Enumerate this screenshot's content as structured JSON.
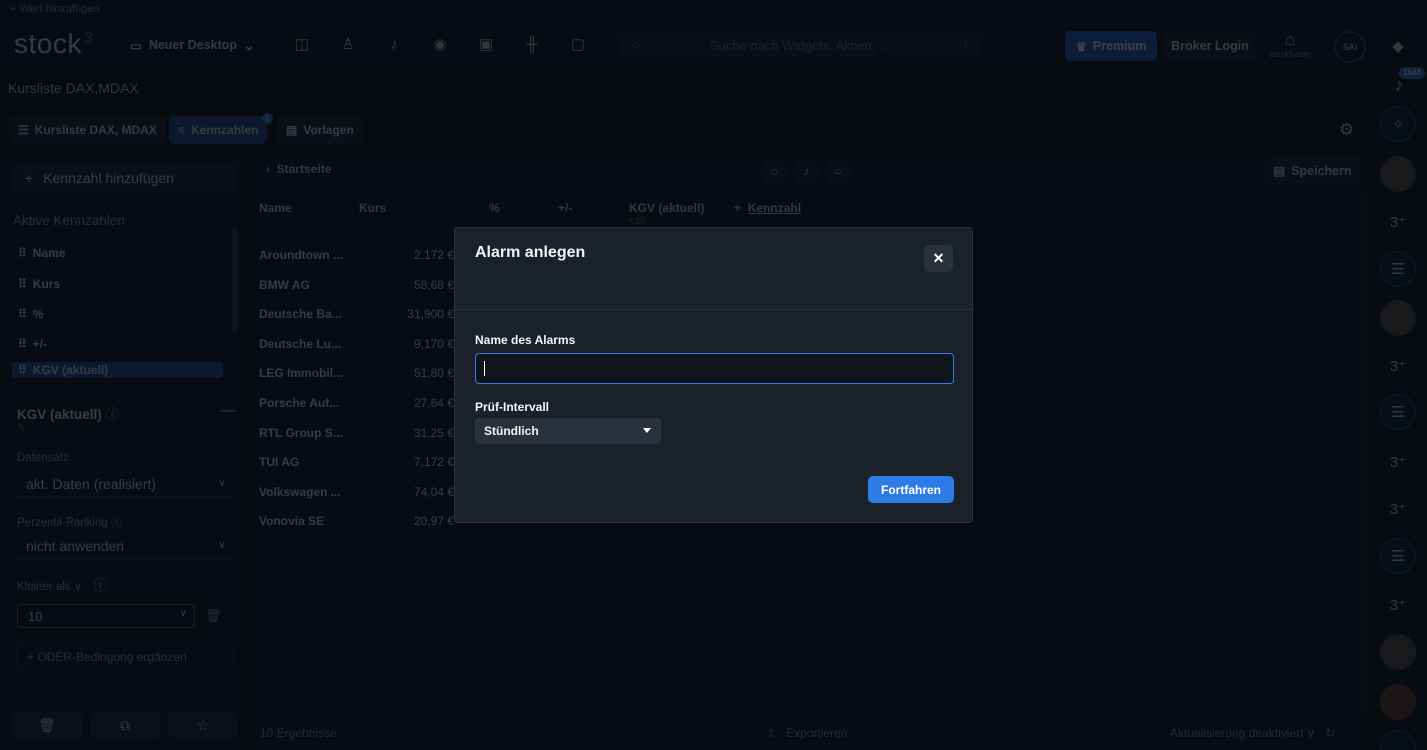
{
  "topbar": {
    "add_value": "+  Wert hinzufügen",
    "logo_text": "stock",
    "logo_sup": "3",
    "desktop_label": "Neuer Desktop",
    "search_placeholder": "Suche nach Widgets, Aktien, ...",
    "premium_label": "Premium",
    "broker_label": "Broker Login",
    "home_caption": "stock3.com",
    "avatar_initials": "SAI"
  },
  "rail": {
    "notification_count": "1644"
  },
  "page": {
    "title": "Kursliste DAX,MDAX",
    "tabs": [
      {
        "label": "Kursliste DAX, MDAX"
      },
      {
        "label": "Kennzahlen",
        "badge": "1"
      },
      {
        "label": "Vorlagen"
      }
    ]
  },
  "sidebar": {
    "add_metric": "Kennzahl hinzufügen",
    "active_title": "Aktive Kennzahlen",
    "items": [
      "Name",
      "Kurs",
      "%",
      "+/-",
      "KGV (aktuell)"
    ],
    "detail_title": "KGV (aktuell)",
    "dataset_label": "Datensatz",
    "dataset_value": "akt. Daten (realisiert)",
    "percentile_label": "Perzentil-Ranking",
    "percentile_value": "nicht anwenden",
    "compare_label": "Kleiner als",
    "compare_value": "10",
    "or_condition": "ODER-Bedingung ergänzen"
  },
  "table": {
    "back_label": "Startseite",
    "save_label": "Speichern",
    "headers": [
      "Name",
      "Kurs",
      "%",
      "+/-",
      "KGV (aktuell)"
    ],
    "kgv_condition": "<10",
    "add_column": "Kennzahl",
    "rows": [
      {
        "name": "Aroundtown ...",
        "price": "2,172 €"
      },
      {
        "name": "BMW AG",
        "price": "58,68 €"
      },
      {
        "name": "Deutsche Ba...",
        "price": "31,900 €"
      },
      {
        "name": "Deutsche Lu...",
        "price": "9,170 €"
      },
      {
        "name": "LEG Immobil...",
        "price": "51,80 €"
      },
      {
        "name": "Porsche Aut...",
        "price": "27,64 €"
      },
      {
        "name": "RTL Group S...",
        "price": "31,25 €"
      },
      {
        "name": "TUI AG",
        "price": "7,172 €"
      },
      {
        "name": "Volkswagen ...",
        "price": "74,04 €"
      },
      {
        "name": "Vonovia SE",
        "price": "20,97 €"
      }
    ],
    "results": "10 Ergebnisse",
    "export": "Exportieren",
    "auto_update": "Aktualisierung deaktiviert"
  },
  "modal": {
    "title": "Alarm anlegen",
    "name_label": "Name des Alarms",
    "name_value": "",
    "interval_label": "Prüf-Intervall",
    "interval_value": "Stündlich",
    "continue_label": "Fortfahren"
  },
  "colors": {
    "accent": "#2e7be5",
    "positive": "#2e8d4e",
    "background": "#0b0f15",
    "modal": "#1b212b"
  },
  "icons": [
    "plus-icon",
    "monitor-icon",
    "layout-icon",
    "people-icon",
    "bell-icon",
    "eye-icon",
    "money-icon",
    "chart-icon",
    "folder-icon",
    "search-icon",
    "mic-icon",
    "crown-icon",
    "home-icon",
    "gear-icon",
    "bank-icon",
    "close-icon",
    "lightbulb-icon",
    "trash-icon",
    "copy-icon",
    "star-icon",
    "export-icon",
    "refresh-icon"
  ]
}
